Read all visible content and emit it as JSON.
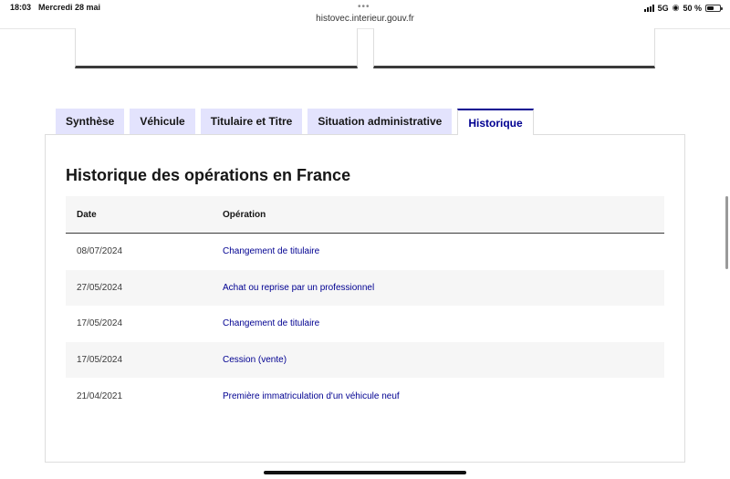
{
  "status_bar": {
    "time": "18:03",
    "date": "Mercredi 28 mai",
    "url": "histovec.interieur.gouv.fr",
    "network": "5G",
    "battery": "50 %",
    "battery_level": 0.5
  },
  "tabs": [
    {
      "label": "Synthèse"
    },
    {
      "label": "Véhicule"
    },
    {
      "label": "Titulaire et Titre"
    },
    {
      "label": "Situation administrative"
    },
    {
      "label": "Historique"
    }
  ],
  "active_tab": "Historique",
  "section": {
    "title": "Historique des opérations en France"
  },
  "table": {
    "headers": {
      "date": "Date",
      "operation": "Opération"
    },
    "rows": [
      {
        "date": "08/07/2024",
        "operation": "Changement de titulaire"
      },
      {
        "date": "27/05/2024",
        "operation": "Achat ou reprise par un professionnel"
      },
      {
        "date": "17/05/2024",
        "operation": "Changement de titulaire"
      },
      {
        "date": "17/05/2024",
        "operation": "Cession (vente)"
      },
      {
        "date": "21/04/2021",
        "operation": "Première immatriculation d'un véhicule neuf"
      }
    ]
  },
  "colors": {
    "accent": "#000091",
    "tab_bg": "#e3e3fd",
    "row_alt": "#f6f6f6"
  }
}
